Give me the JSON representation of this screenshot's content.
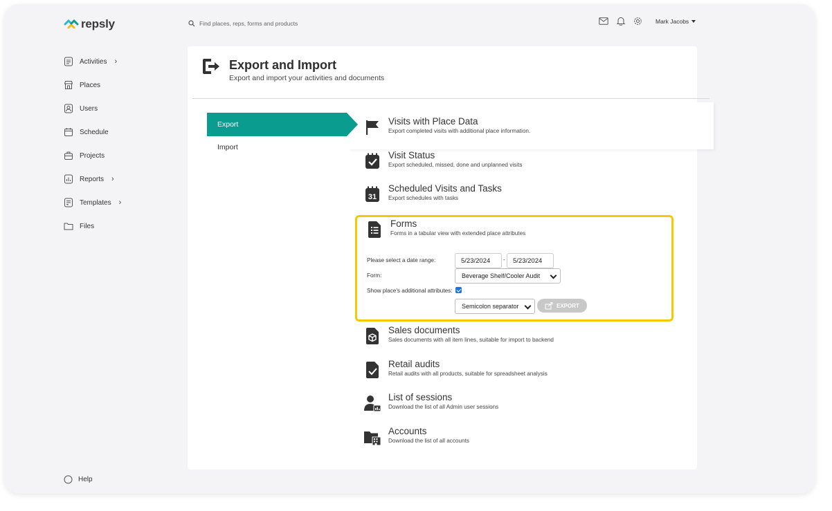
{
  "app": {
    "logo_text": "repsly"
  },
  "search": {
    "placeholder": "Find places, reps, forms and products"
  },
  "header": {
    "user_name": "Mark Jacobs"
  },
  "sidebar": {
    "items": [
      {
        "label": "Activities",
        "icon": "list-icon",
        "has_chevron": true
      },
      {
        "label": "Places",
        "icon": "store-icon",
        "has_chevron": false
      },
      {
        "label": "Users",
        "icon": "user-icon",
        "has_chevron": false
      },
      {
        "label": "Schedule",
        "icon": "calendar-icon",
        "has_chevron": false
      },
      {
        "label": "Projects",
        "icon": "briefcase-icon",
        "has_chevron": false
      },
      {
        "label": "Reports",
        "icon": "chart-icon",
        "has_chevron": true
      },
      {
        "label": "Templates",
        "icon": "template-icon",
        "has_chevron": true
      },
      {
        "label": "Files",
        "icon": "folder-icon",
        "has_chevron": false
      }
    ],
    "help_label": "Help"
  },
  "page": {
    "title": "Export and Import",
    "subtitle": "Export and import your activities and documents"
  },
  "tabs": {
    "export": "Export",
    "import": "Import"
  },
  "exports": [
    {
      "title": "Visits with Place Data",
      "desc": "Export completed visits with additional place information.",
      "icon": "flag-icon"
    },
    {
      "title": "Visit Status",
      "desc": "Export scheduled, missed, done and unplanned visits",
      "icon": "checkbox-icon"
    },
    {
      "title": "Scheduled Visits and Tasks",
      "desc": "Export schedules with tasks",
      "icon": "calendar-31-icon",
      "icon_text": "31"
    },
    {
      "title": "Forms",
      "desc": "Forms in a tabular view with extended place attributes",
      "icon": "form-icon"
    },
    {
      "title": "Sales documents",
      "desc": "Sales documents with all item lines, suitable for import to backend",
      "icon": "sales-document-icon"
    },
    {
      "title": "Retail audits",
      "desc": "Retail audits with all products, suitable for spreadsheet analysis",
      "icon": "audit-icon"
    },
    {
      "title": "List of sessions",
      "desc": "Download the list of all Admin user sessions",
      "icon": "sessions-icon"
    },
    {
      "title": "Accounts",
      "desc": "Download the list of all accounts",
      "icon": "accounts-icon"
    }
  ],
  "forms": {
    "date_range_label": "Please select a date range:",
    "date_from": "5/23/2024",
    "date_separator": "-",
    "date_to": "5/23/2024",
    "form_label": "Form:",
    "form_value": "Beverage Shelf/Cooler Audit",
    "attributes_label": "Show place's additional attributes:",
    "attributes_checked": true,
    "separator_value": "Semicolon separator",
    "export_button": "EXPORT"
  },
  "colors": {
    "accent": "#0a9d8f",
    "highlight": "#f5c800",
    "disabled": "#c8c8c8"
  }
}
